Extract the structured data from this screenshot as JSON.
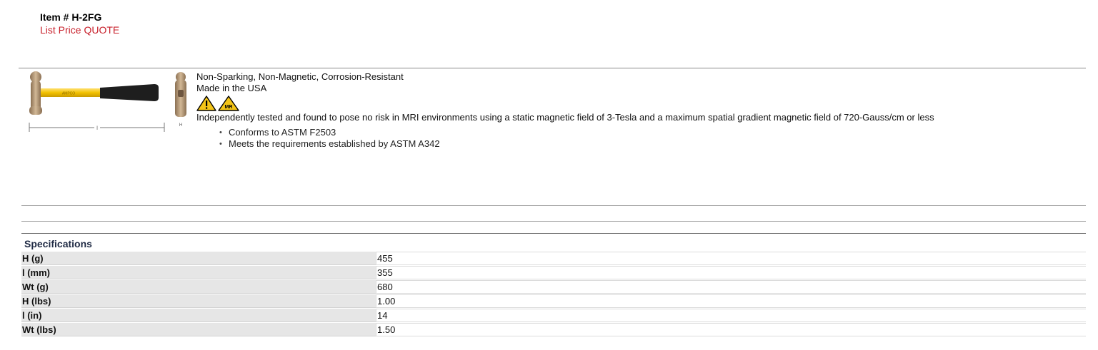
{
  "item": {
    "number_label": "Item # H-2FG",
    "list_price": "List Price QUOTE"
  },
  "product": {
    "handle_brand": "AMPCO",
    "dimension_l": "l",
    "dimension_h": "H",
    "features": [
      "Non-Sparking, Non-Magnetic, Corrosion-Resistant",
      "Made in the USA"
    ],
    "badges": [
      {
        "icon": "warning-triangle-icon",
        "text": ""
      },
      {
        "icon": "mri-safe-icon",
        "text": "MR"
      }
    ],
    "mri_statement": "Independently tested and found to pose no risk in MRI environments using a static magnetic field of 3-Tesla and a maximum spatial gradient magnetic field of 720-Gauss/cm or less",
    "standards": [
      "Conforms to ASTM F2503",
      "Meets the requirements established by ASTM A342"
    ]
  },
  "specifications": {
    "title": "Specifications",
    "rows": [
      {
        "label": "H (g)",
        "value": "455"
      },
      {
        "label": "l (mm)",
        "value": "355"
      },
      {
        "label": "Wt (g)",
        "value": "680"
      },
      {
        "label": "H (lbs)",
        "value": "1.00"
      },
      {
        "label": "l (in)",
        "value": "14"
      },
      {
        "label": "Wt (lbs)",
        "value": "1.50"
      }
    ]
  },
  "colors": {
    "price_red": "#c8202b",
    "handle_yellow": "#f2c100",
    "bronze": "#b79a78",
    "grip_black": "#1e1e1e",
    "badge_yellow": "#f4c518",
    "spec_label_bg": "#e6e6e6",
    "spec_title": "#1f2a44"
  }
}
